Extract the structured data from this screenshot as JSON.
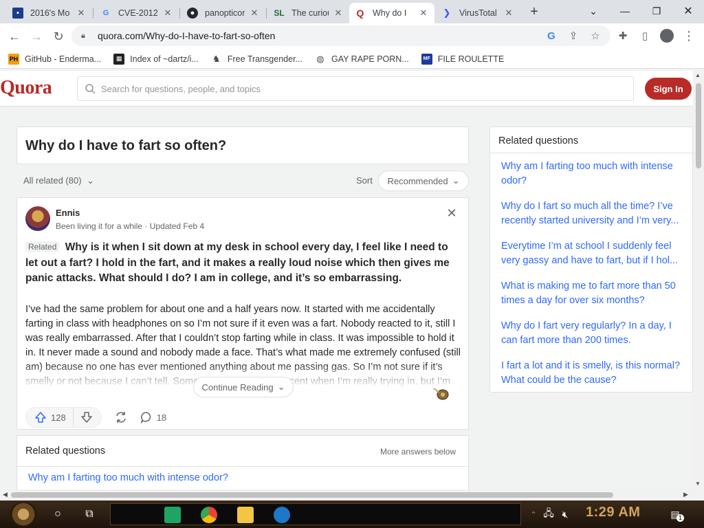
{
  "browser": {
    "tabs": [
      {
        "title": "2016's Mo",
        "favicon": "doc-icon",
        "active": false
      },
      {
        "title": "CVE-2012-",
        "favicon": "google-icon",
        "active": false
      },
      {
        "title": "panopticon",
        "favicon": "github-icon",
        "active": false
      },
      {
        "title": "The curiou",
        "favicon": "sl-icon",
        "active": false
      },
      {
        "title": "Why do I",
        "favicon": "quora-icon",
        "active": true
      },
      {
        "title": "VirusTotal",
        "favicon": "virustotal-icon",
        "active": false
      }
    ],
    "url": "quora.com/Why-do-I-have-to-fart-so-often",
    "bookmarks": [
      {
        "label": "GitHub - Enderma...",
        "icon": "ph-icon"
      },
      {
        "label": "Index of ~dartz/i...",
        "icon": "qr-icon"
      },
      {
        "label": "Free Transgender...",
        "icon": "figure-icon"
      },
      {
        "label": "GAY RAPE PORN...",
        "icon": "globe-icon"
      },
      {
        "label": "FILE ROULETTE",
        "icon": "mfm-icon"
      }
    ]
  },
  "quora": {
    "logo": "Quora",
    "search_placeholder": "Search for questions, people, and topics",
    "signin_label": "Sign In",
    "question_title": "Why do I have to fart so often?",
    "all_related": "All related (80)",
    "sort_label": "Sort",
    "sort_value": "Recommended",
    "answer": {
      "author": "Ennis",
      "credential": "Been living it for a while · Updated Feb 4",
      "related_tag": "Related",
      "related_question": "Why is it when I sit down at my desk in school every day, I feel like I need to let out a fart? I hold in the fart, and it makes a really loud noise which then gives me panic attacks. What should I do? I am in college, and it’s so embarrassing.",
      "body": "I’ve had the same problem for about one and a half years now. It started with me accidentally farting in class with headphones on so I’m not sure if it even was a fart. Nobody reacted to it, still I was really embarrassed. After that I couldn’t stop farting while in class. It was impossible to hold it in. It never made a sound and nobody made a face. That’s what made me extremely confused (still am) because no one has ever mentioned anything about me passing gas. So I’m not sure if it’s smelly or not because I can’t tell. Sometimes I feel a small scent when I’m really trying in, but I’m no",
      "continue_reading": "Continue Reading",
      "upvotes": "128",
      "comments": "18"
    },
    "related_card": {
      "heading": "Related questions",
      "more_answers": "More answers below",
      "first_link": "Why am I farting too much with intense odor?"
    },
    "sidebar": {
      "heading": "Related questions",
      "items": [
        "Why am I farting too much with intense odor?",
        "Why do I fart so much all the time? I’ve recently started university and I’m very...",
        "Everytime I’m at school I suddenly feel very gassy and have to fart, but if I hol...",
        "What is making me to fart more than 50 times a day for over six months?",
        "Why do I fart very regularly? In a day, I can fart more than 200 times.",
        "I fart a lot and it is smelly, is this normal? What could be the cause?"
      ]
    }
  },
  "taskbar": {
    "clock": "1:29 AM",
    "notification_count": "1"
  },
  "colors": {
    "quora_red": "#b92b27",
    "link_blue": "#2e69ff"
  }
}
